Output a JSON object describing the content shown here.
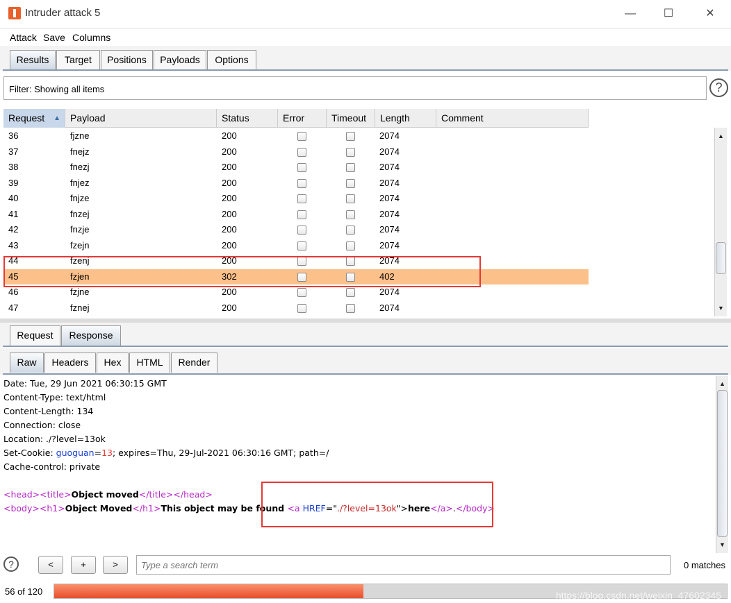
{
  "window": {
    "title": "Intruder attack 5",
    "minimize": "—",
    "maximize": "☐",
    "close": "✕"
  },
  "menu": [
    "Attack",
    "Save",
    "Columns"
  ],
  "tabs": [
    "Results",
    "Target",
    "Positions",
    "Payloads",
    "Options"
  ],
  "active_tab": "Results",
  "filter": {
    "text": "Filter: Showing all items",
    "help": "?"
  },
  "table": {
    "columns": [
      "Request",
      "Payload",
      "Status",
      "Error",
      "Timeout",
      "Length",
      "Comment"
    ],
    "sort_indicator": "▲",
    "rows": [
      {
        "request": "36",
        "payload": "fjzne",
        "status": "200",
        "length": "2074"
      },
      {
        "request": "37",
        "payload": "fnejz",
        "status": "200",
        "length": "2074"
      },
      {
        "request": "38",
        "payload": "fnezj",
        "status": "200",
        "length": "2074"
      },
      {
        "request": "39",
        "payload": "fnjez",
        "status": "200",
        "length": "2074"
      },
      {
        "request": "40",
        "payload": "fnjze",
        "status": "200",
        "length": "2074"
      },
      {
        "request": "41",
        "payload": "fnzej",
        "status": "200",
        "length": "2074"
      },
      {
        "request": "42",
        "payload": "fnzje",
        "status": "200",
        "length": "2074"
      },
      {
        "request": "43",
        "payload": "fzejn",
        "status": "200",
        "length": "2074"
      },
      {
        "request": "44",
        "payload": "fzenj",
        "status": "200",
        "length": "2074"
      },
      {
        "request": "45",
        "payload": "fzjen",
        "status": "302",
        "length": "402"
      },
      {
        "request": "46",
        "payload": "fzjne",
        "status": "200",
        "length": "2074"
      },
      {
        "request": "47",
        "payload": "fznej",
        "status": "200",
        "length": "2074"
      }
    ],
    "highlight_color": "#fcc08a",
    "scroll_up": "▲",
    "scroll_down": "▼"
  },
  "detail_tabs": [
    "Request",
    "Response"
  ],
  "active_detail_tab": "Response",
  "view_tabs": [
    "Raw",
    "Headers",
    "Hex",
    "HTML",
    "Render"
  ],
  "active_view_tab": "Raw",
  "response": {
    "headers": [
      "Date: Tue, 29 Jun 2021 06:30:15 GMT",
      "Content-Type: text/html",
      "Content-Length: 134",
      "Connection: close",
      "Location: ./?level=13ok"
    ],
    "cookie_prefix": "Set-Cookie: ",
    "cookie_name": "guoguan",
    "cookie_eq": "=",
    "cookie_value": "13",
    "cookie_rest": "; expires=Thu, 29-Jul-2021 06:30:16 GMT; path=/",
    "cache": "Cache-control: private",
    "html_line1": {
      "head_open": "<head>",
      "title_open": "<title>",
      "title_text": "Object moved",
      "title_close": "</title>",
      "head_close": "</head>"
    },
    "html_line2": {
      "body_open": "<body>",
      "h1_open": "<h1>",
      "h1_text": "Object Moved",
      "h1_close": "</h1>",
      "text": "This object may be found ",
      "a_open": "<a",
      "attr_name": " HREF",
      "attr_eq": "=\"",
      "attr_value": "./?level=13ok",
      "attr_end": "\">",
      "link_text": "here",
      "a_close": "</a>",
      "dot": ".",
      "body_close": "</body>"
    }
  },
  "search": {
    "help": "?",
    "prev": "<",
    "add": "+",
    "next": ">",
    "placeholder": "Type a search term",
    "matches": "0 matches"
  },
  "progress": {
    "label": "56 of 120",
    "fraction": 0.46,
    "watermark": "https://blog.csdn.net/weixin_47602345"
  }
}
